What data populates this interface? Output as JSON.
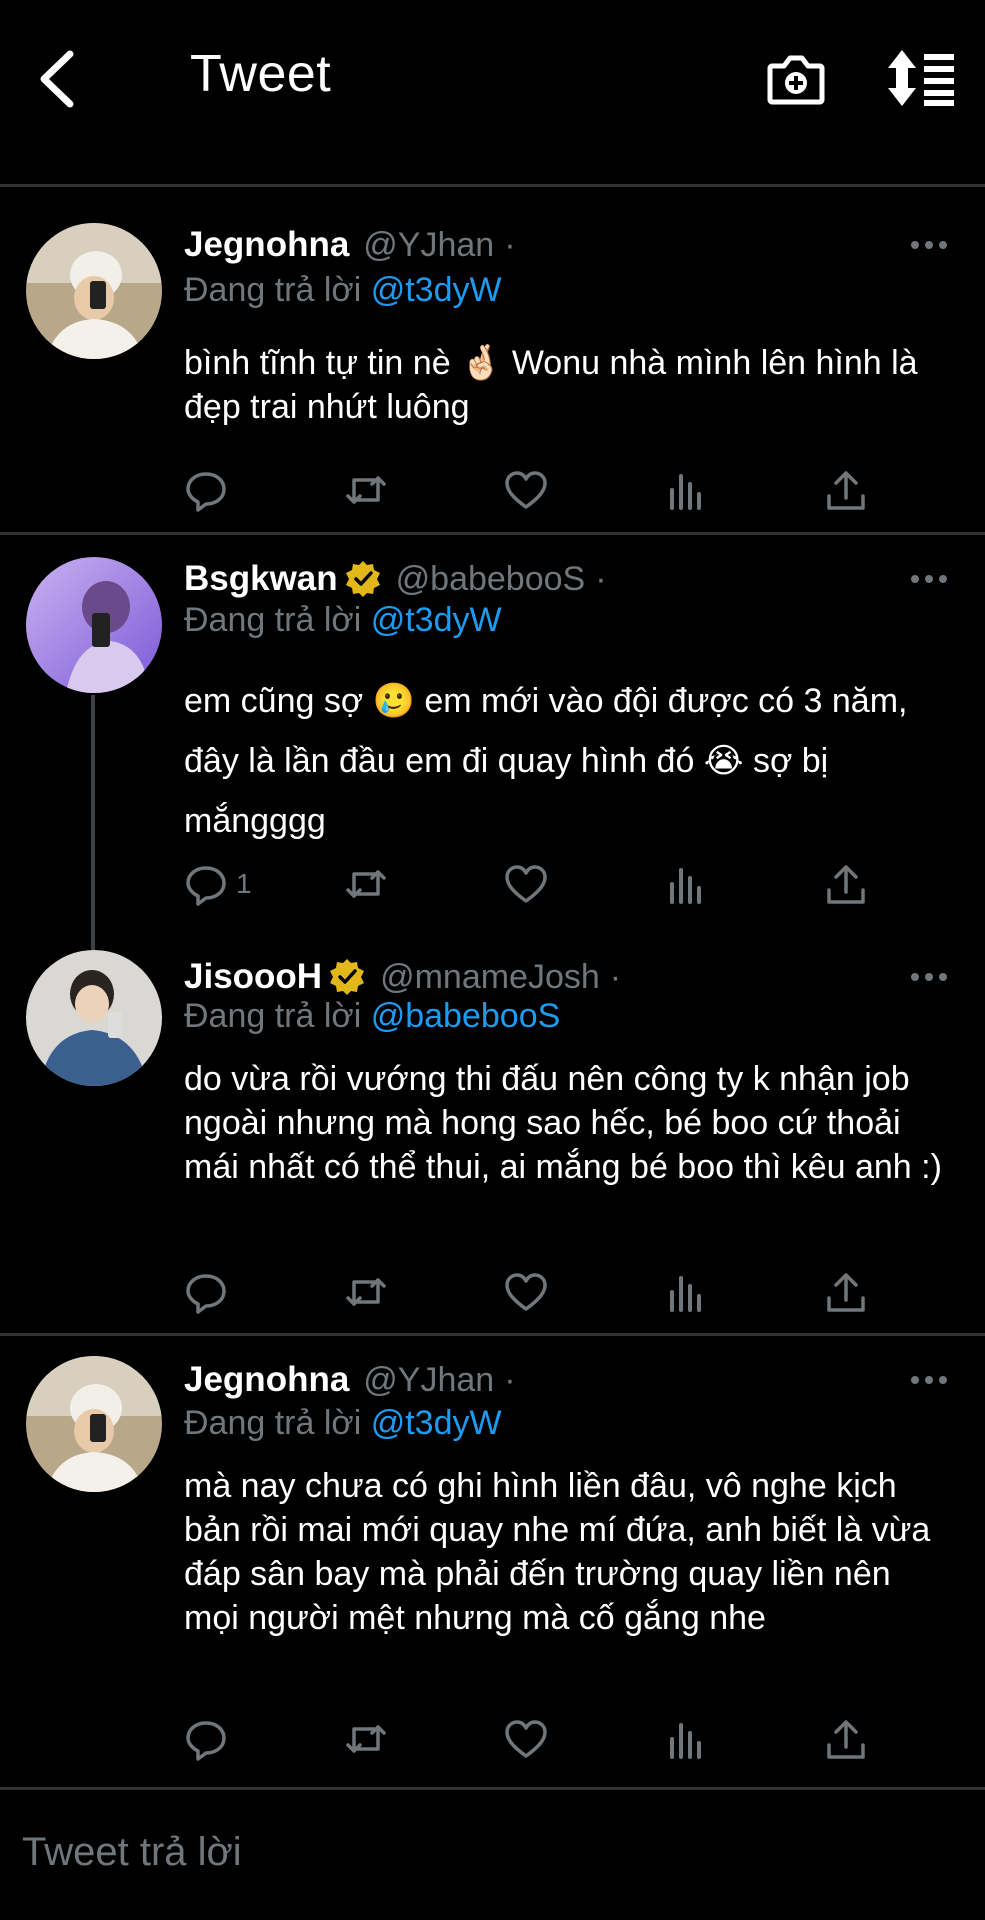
{
  "header": {
    "title": "Tweet",
    "back_icon": "chevron-left-icon",
    "camera_icon": "camera-plus-icon",
    "sort_icon": "sort-list-icon"
  },
  "tweets": [
    {
      "name": "Jegnohna",
      "handle": "@YJhan",
      "dot": "·",
      "verified": false,
      "reply_prefix": "Đang trả lời",
      "reply_to": "@t3dyW",
      "text": "bình tĩnh tự tin nè 🤞🏻 Wonu nhà mình lên hình là đẹp trai nhứt luông",
      "reply_count": ""
    },
    {
      "name": "Bsgkwan",
      "handle": "@babebooS",
      "dot": "·",
      "verified": true,
      "reply_prefix": "Đang trả lời",
      "reply_to": "@t3dyW",
      "text": "em cũng sợ 🥲 em mới vào đội được có 3 năm, đây là lần đầu em đi quay hình đó 😭 sợ bị mắngggg",
      "reply_count": "1"
    },
    {
      "name": "JisoooH",
      "handle": "@mnameJosh",
      "dot": "·",
      "verified": true,
      "reply_prefix": "Đang trả lời",
      "reply_to": "@babebooS",
      "text": "do vừa rồi vướng thi đấu nên công ty k nhận job ngoài nhưng mà hong sao hếc, bé boo cứ thoải mái nhất có thể thui, ai mắng bé boo thì kêu anh :)",
      "reply_count": ""
    },
    {
      "name": "Jegnohna",
      "handle": "@YJhan",
      "dot": "·",
      "verified": false,
      "reply_prefix": "Đang trả lời",
      "reply_to": "@t3dyW",
      "text": "mà nay chưa có ghi hình liền đâu, vô nghe kịch bản rồi mai mới quay nhe mí đứa, anh biết là vừa đáp sân bay mà phải đến trường quay liền nên mọi người mệt nhưng mà cố gắng nhe",
      "reply_count": ""
    }
  ],
  "compose": {
    "placeholder": "Tweet trả lời"
  },
  "colors": {
    "background": "#000000",
    "text": "#e7e9ea",
    "secondary": "#71767b",
    "mention": "#1d9bf0",
    "verified": "#e2b719"
  }
}
